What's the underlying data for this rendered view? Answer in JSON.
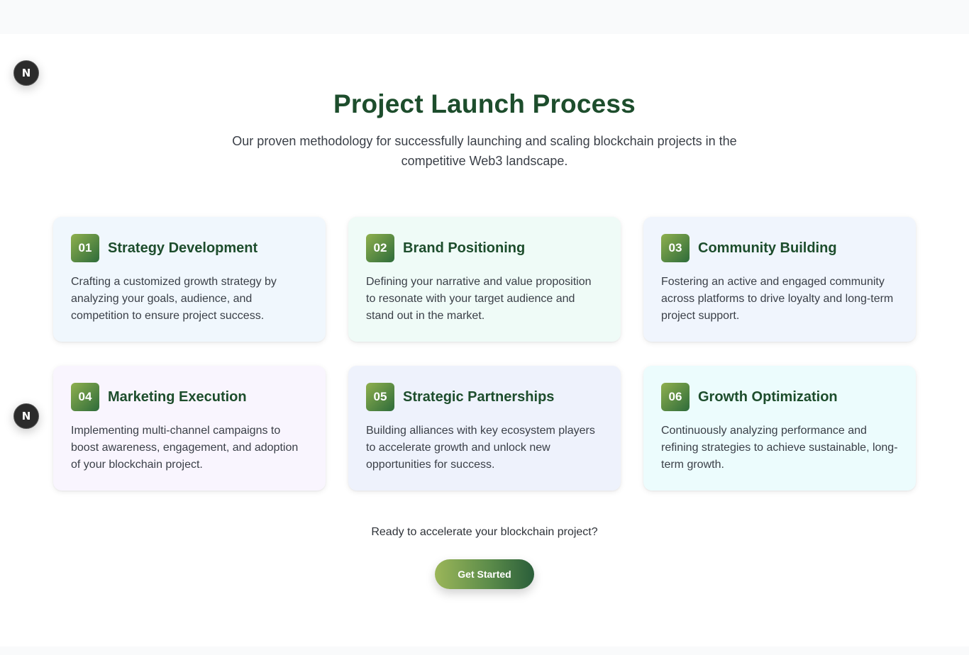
{
  "devtools_badge": {
    "glyph": "N",
    "icon": "nextjs-logo-icon"
  },
  "section": {
    "title": "Project Launch Process",
    "subtitle": "Our proven methodology for successfully launching and scaling blockchain projects in the competitive Web3 landscape."
  },
  "steps": [
    {
      "number": "01",
      "title": "Strategy Development",
      "description": "Crafting a customized growth strategy by analyzing your goals, audience, and competition to ensure project success."
    },
    {
      "number": "02",
      "title": "Brand Positioning",
      "description": "Defining your narrative and value proposition to resonate with your target audience and stand out in the market."
    },
    {
      "number": "03",
      "title": "Community Building",
      "description": "Fostering an active and engaged community across platforms to drive loyalty and long-term project support."
    },
    {
      "number": "04",
      "title": "Marketing Execution",
      "description": "Implementing multi-channel campaigns to boost awareness, engagement, and adoption of your blockchain project."
    },
    {
      "number": "05",
      "title": "Strategic Partnerships",
      "description": "Building alliances with key ecosystem players to accelerate growth and unlock new opportunities for success."
    },
    {
      "number": "06",
      "title": "Growth Optimization",
      "description": "Continuously analyzing performance and refining strategies to achieve sustainable, long-term growth."
    }
  ],
  "cta": {
    "text": "Ready to accelerate your blockchain project?",
    "button_label": "Get Started"
  },
  "colors": {
    "heading": "#1d4d2c",
    "accent_start": "#9bb659",
    "accent_end": "#2a5e3a"
  }
}
